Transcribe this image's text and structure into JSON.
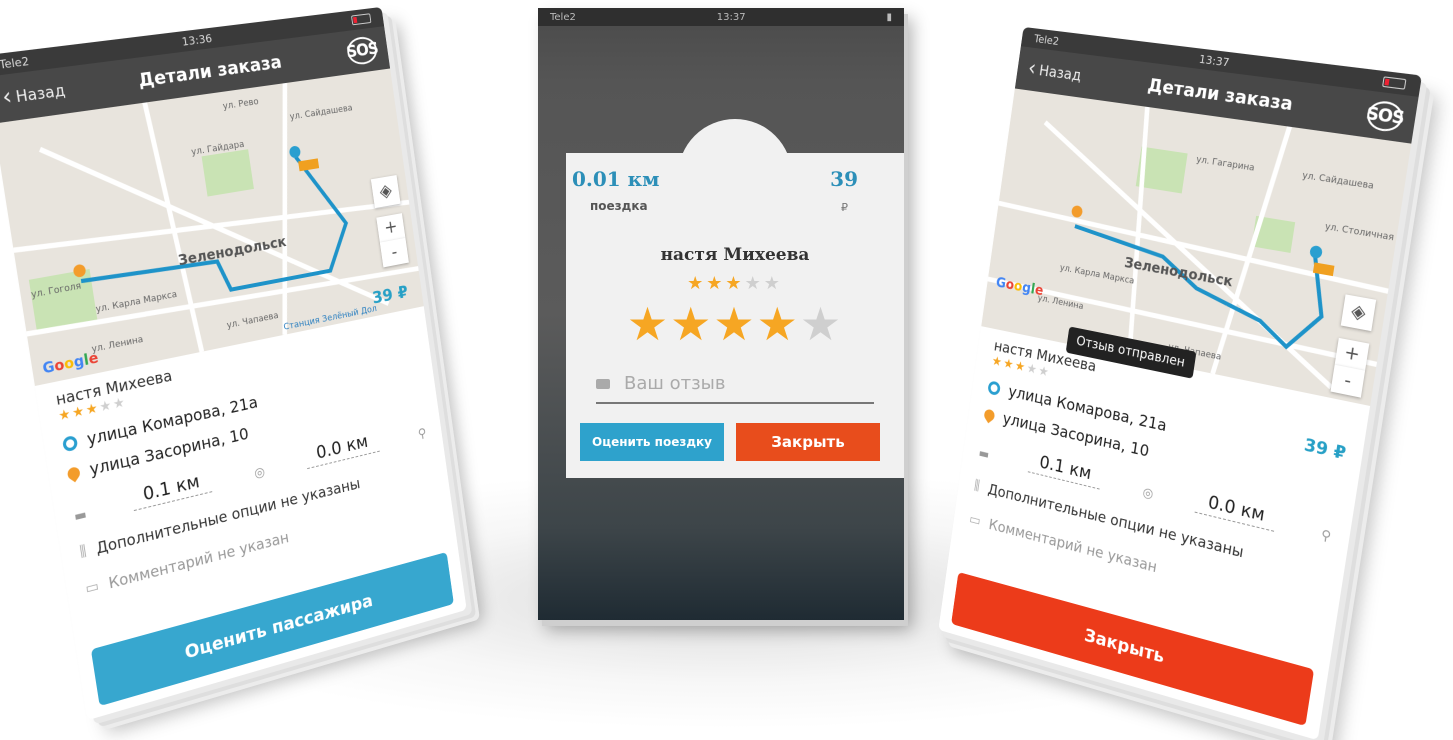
{
  "status": {
    "carrier": "Tele2",
    "time_left": "13:36",
    "time_center": "13:37",
    "time_right": "13:37"
  },
  "nav": {
    "back_label": "Назад",
    "title": "Детали заказа",
    "sos_label": "SOS"
  },
  "map": {
    "city_label": "Зеленодольск",
    "streets": [
      "ул. Гоголя",
      "ул. Карла Маркса",
      "ул. Ленина",
      "ул. Чапаева",
      "ул. Гайдара",
      "ул. Сайдашева",
      "ул. Рево",
      "ул. Гагарина",
      "ул. Столичная"
    ],
    "station_label": "Станция Зелёный Дол",
    "zoom_in": "+",
    "zoom_out": "-",
    "google": [
      "G",
      "o",
      "o",
      "g",
      "l",
      "e"
    ]
  },
  "order": {
    "price": "39 ₽",
    "passenger_name": "настя Михеева",
    "passenger_rating": 3,
    "rating_max": 5,
    "from_address": "улица Комарова, 21а",
    "to_address": "улица Засорина, 10",
    "distance_traveled": "0.1 км",
    "distance_remaining": "0.0 км",
    "options": "Дополнительные опции не указаны",
    "comment": "Комментарий не указан"
  },
  "left_screen": {
    "action_button": "Оценить пассажира"
  },
  "right_screen": {
    "toast": "Отзыв отправлен",
    "action_button": "Закрыть"
  },
  "rating_dialog": {
    "distance": "0.01 км",
    "distance_label": "поездка",
    "cost": "39",
    "currency": "₽",
    "name": "настя Михеева",
    "passenger_rating": 3,
    "given_rating": 4,
    "review_placeholder": "Ваш отзыв",
    "rate_button": "Оценить поездку",
    "close_button": "Закрыть"
  },
  "colors": {
    "accent_blue": "#37a7cf",
    "accent_red": "#ec3b1a",
    "star": "#f6a623",
    "route": "#1e93c9"
  }
}
